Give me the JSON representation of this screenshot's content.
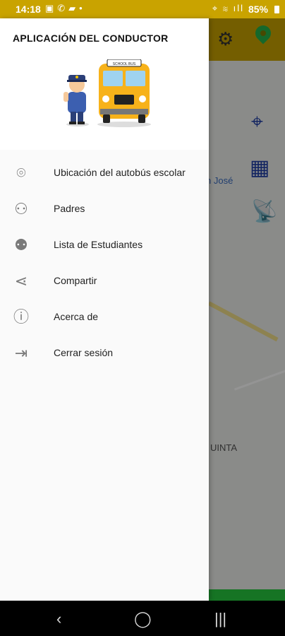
{
  "status": {
    "time": "14:18",
    "battery": "85%"
  },
  "drawer": {
    "title": "APLICACIÓN DEL CONDUCTOR",
    "bus_sign": "SCHOOL BUS",
    "menu": [
      {
        "label": "Ubicación del autobús escolar",
        "icon": "location-pin-icon"
      },
      {
        "label": "Padres",
        "icon": "parents-icon"
      },
      {
        "label": "Lista de Estudiantes",
        "icon": "students-icon"
      },
      {
        "label": "Compartir",
        "icon": "share-icon"
      },
      {
        "label": "Acerca de",
        "icon": "info-icon"
      },
      {
        "label": "Cerrar sesión",
        "icon": "logout-icon"
      }
    ]
  },
  "map": {
    "place1": "n José",
    "place2": "UINTA"
  },
  "colors": {
    "appbar": "#c9a300",
    "accent_green": "#27c93f",
    "map_icon": "#1f3fa8"
  }
}
